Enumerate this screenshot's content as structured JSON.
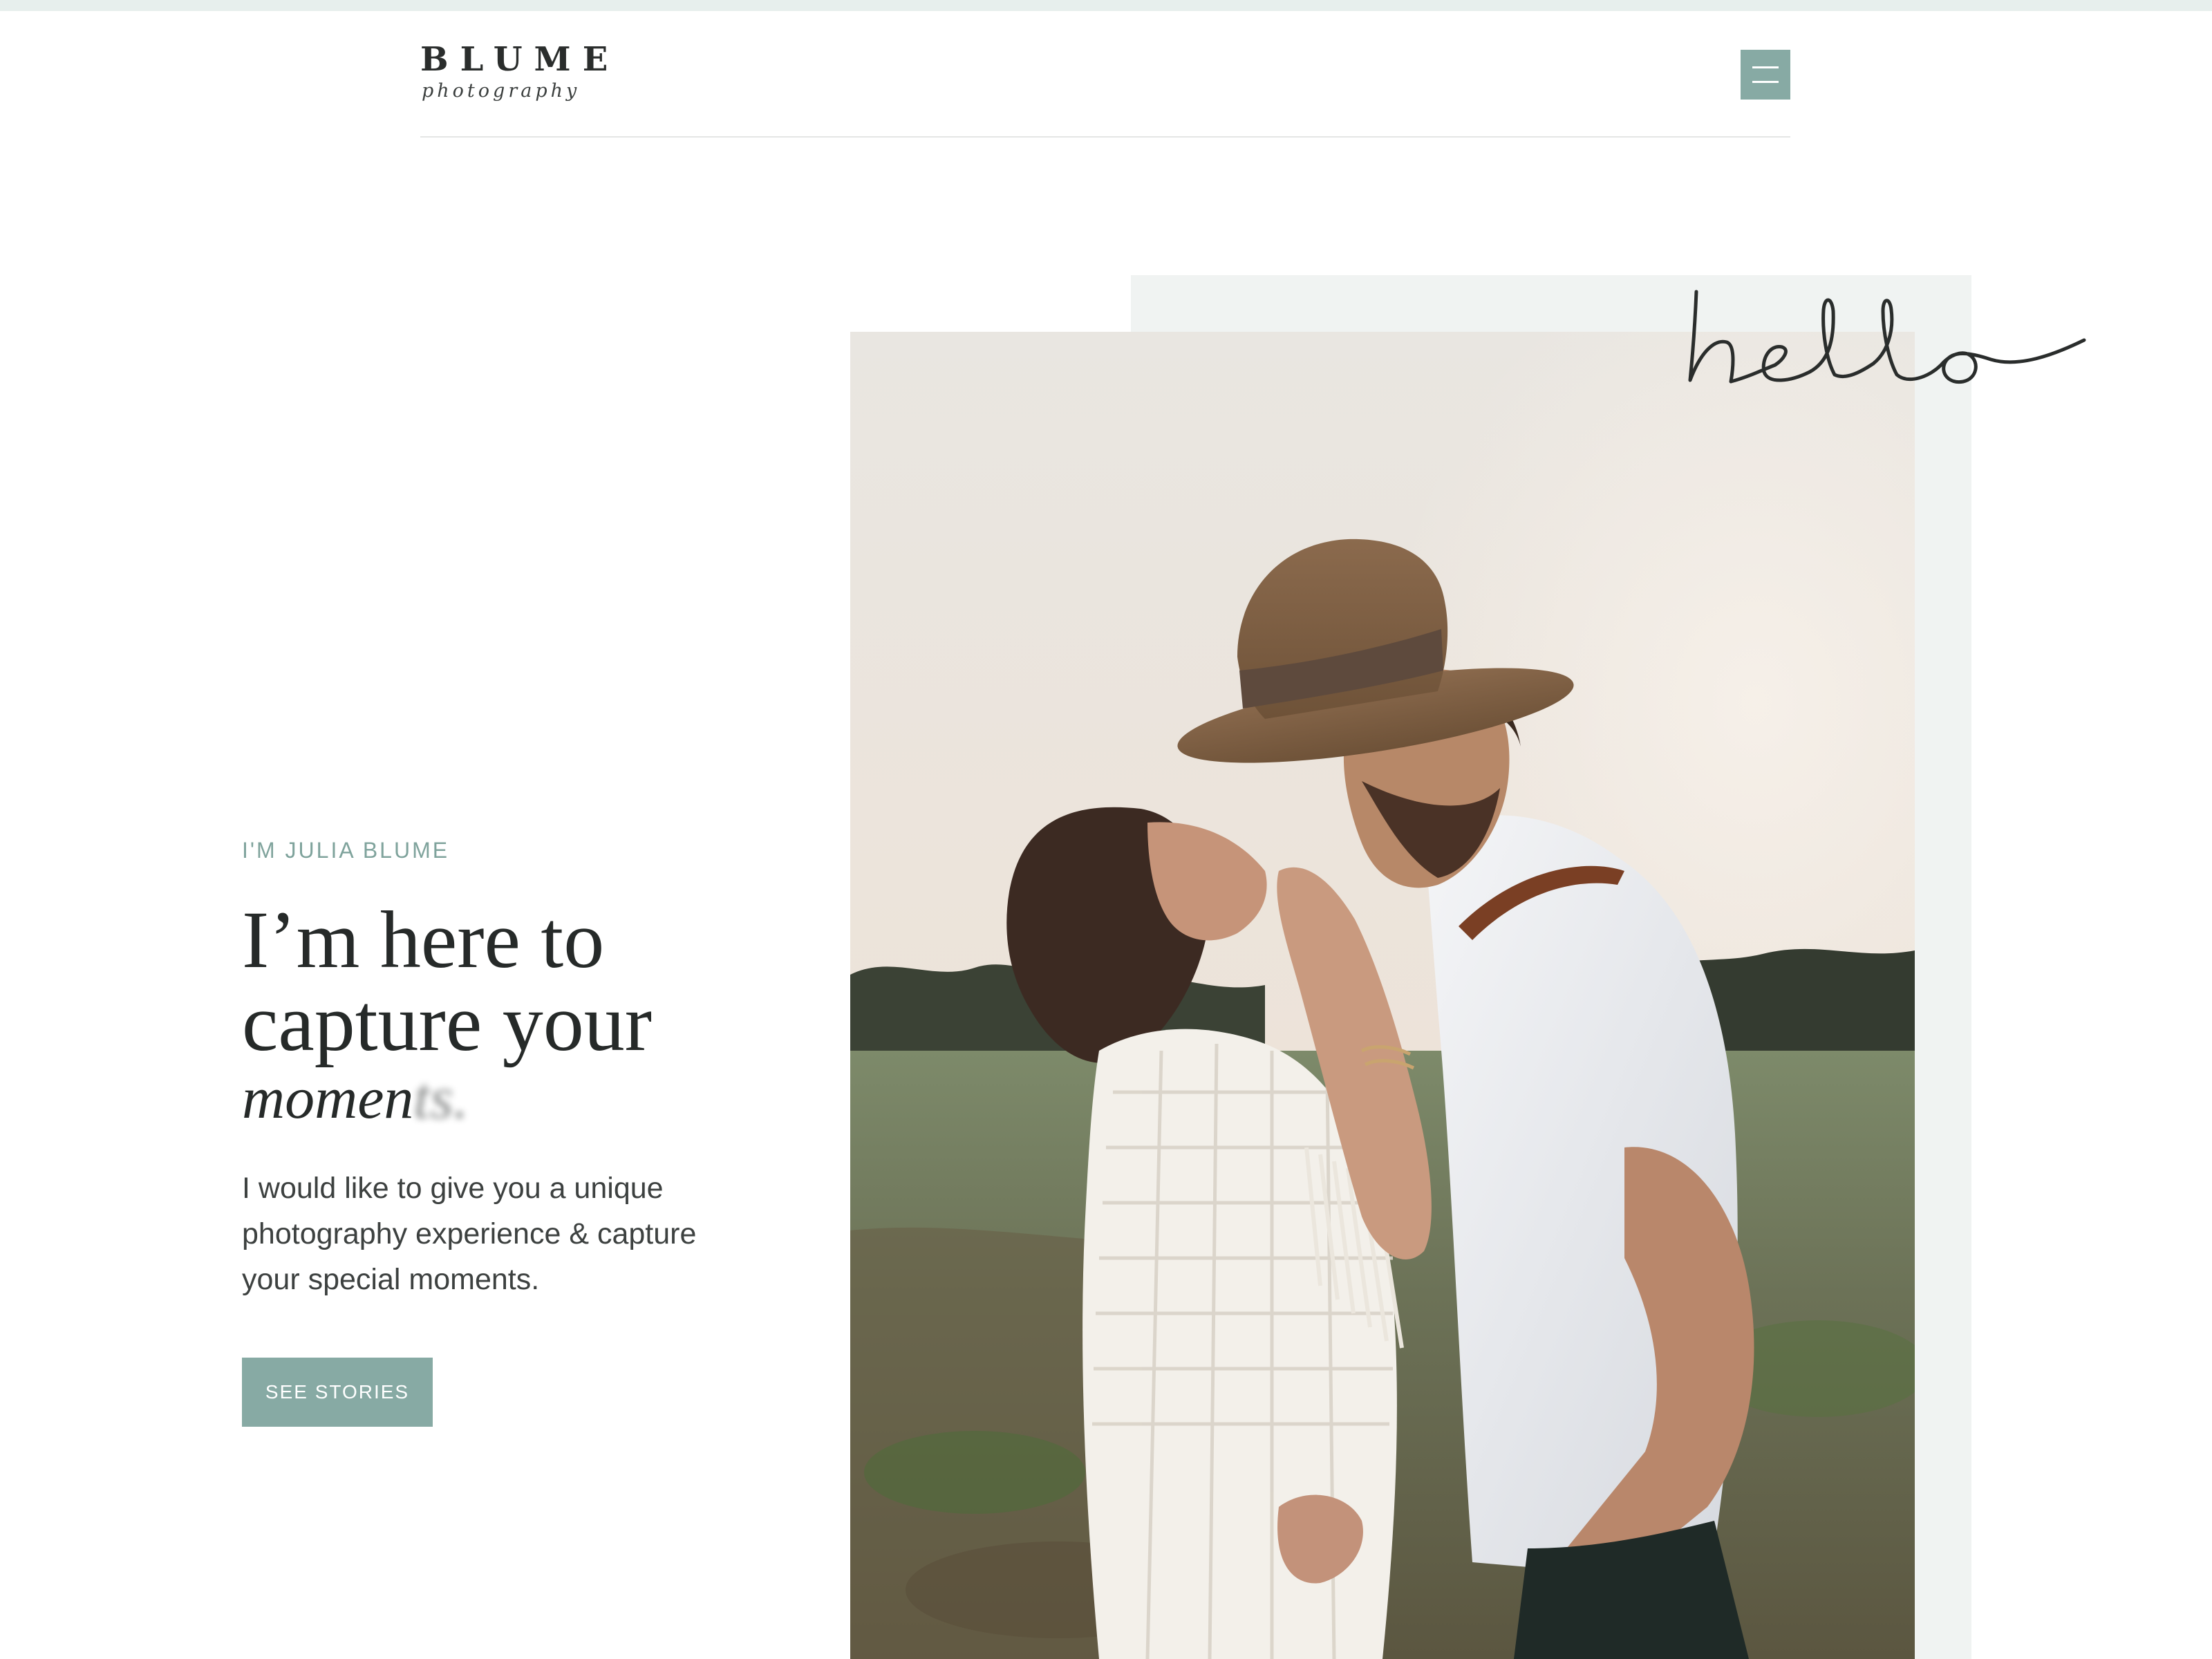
{
  "colors": {
    "accent": "#87aaa4",
    "eyebrow": "#7fa39c",
    "text_dark": "#262a29",
    "text_body": "#3d4140",
    "photo_backing": "#f0f3f2",
    "top_strip": "#e7efed"
  },
  "header": {
    "logo_wordmark": "BLUME",
    "logo_subtitle": "photography",
    "menu_icon": "hamburger-menu-icon"
  },
  "hero": {
    "script_greeting": "hello",
    "eyebrow": "I'M JULIA BLUME",
    "headline_line1": "I’m here to",
    "headline_line2": "capture your",
    "headline_accent_start": "momen",
    "headline_accent_end": "ts.",
    "intro": "I would like to give you a unique photography experience & capture your special moments.",
    "cta_label": "SEE STORIES",
    "photo_alt": "Couple embracing in a field at sunset"
  }
}
